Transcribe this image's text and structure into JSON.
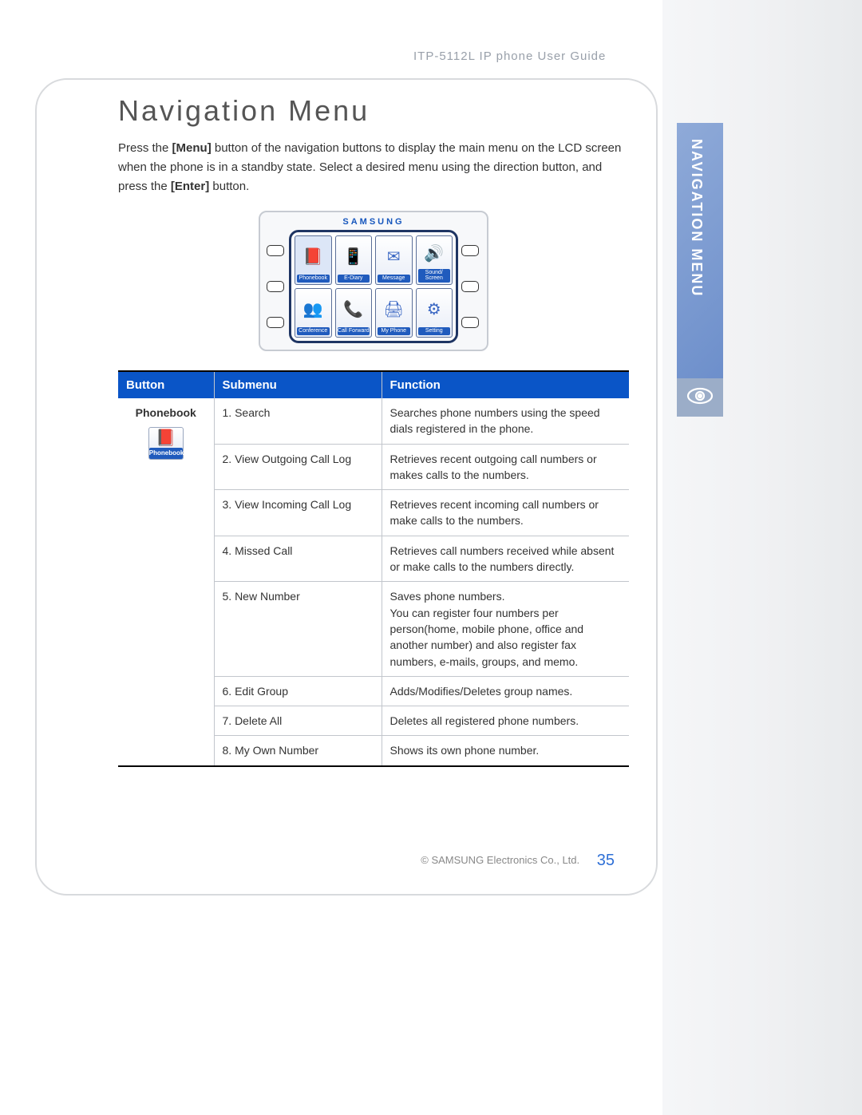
{
  "header": "ITP-5112L IP phone User Guide",
  "rail_label": "NAVIGATION MENU",
  "title": "Navigation Menu",
  "intro_parts": {
    "p1": "Press the ",
    "b1": "[Menu]",
    "p2": " button of the navigation buttons to display the main menu on the LCD screen when the phone is in a standby state. Select a desired menu using the direction button, and press the ",
    "b2": "[Enter]",
    "p3": " button."
  },
  "figure": {
    "brand": "SAMSUNG",
    "cells": [
      {
        "label": "Phonebook",
        "icon": "📕"
      },
      {
        "label": "E-Diary",
        "icon": "📱"
      },
      {
        "label": "Message",
        "icon": "✉"
      },
      {
        "label": "Sound/ Screen",
        "icon": "🔊"
      },
      {
        "label": "Conference",
        "icon": "👥"
      },
      {
        "label": "Call Forward",
        "icon": "📞"
      },
      {
        "label": "My Phone",
        "icon": "🖨"
      },
      {
        "label": "Setting",
        "icon": "⚙"
      }
    ]
  },
  "table": {
    "headers": {
      "c1": "Button",
      "c2": "Submenu",
      "c3": "Function"
    },
    "button_group": {
      "label": "Phonebook",
      "icon_label": "Phonebook"
    },
    "rows": [
      {
        "sub": "1. Search",
        "fn": "Searches phone numbers using the speed dials registered in the phone."
      },
      {
        "sub": "2. View Outgoing Call Log",
        "fn": "Retrieves recent outgoing call numbers or makes calls to the numbers."
      },
      {
        "sub": "3. View Incoming Call Log",
        "fn": "Retrieves recent incoming call numbers or make calls to the numbers."
      },
      {
        "sub": "4. Missed Call",
        "fn": "Retrieves call numbers received while absent or make calls to the numbers directly."
      },
      {
        "sub": "5. New Number",
        "fn": "Saves phone numbers.\nYou can register four numbers per person(home, mobile phone, office and another number) and also register fax numbers, e-mails, groups, and memo."
      },
      {
        "sub": "6. Edit Group",
        "fn": "Adds/Modifies/Deletes group names."
      },
      {
        "sub": "7. Delete All",
        "fn": "Deletes all registered phone numbers."
      },
      {
        "sub": "8. My Own Number",
        "fn": "Shows its own phone number."
      }
    ]
  },
  "footer": {
    "copyright": "© SAMSUNG Electronics Co., Ltd.",
    "page": "35"
  }
}
